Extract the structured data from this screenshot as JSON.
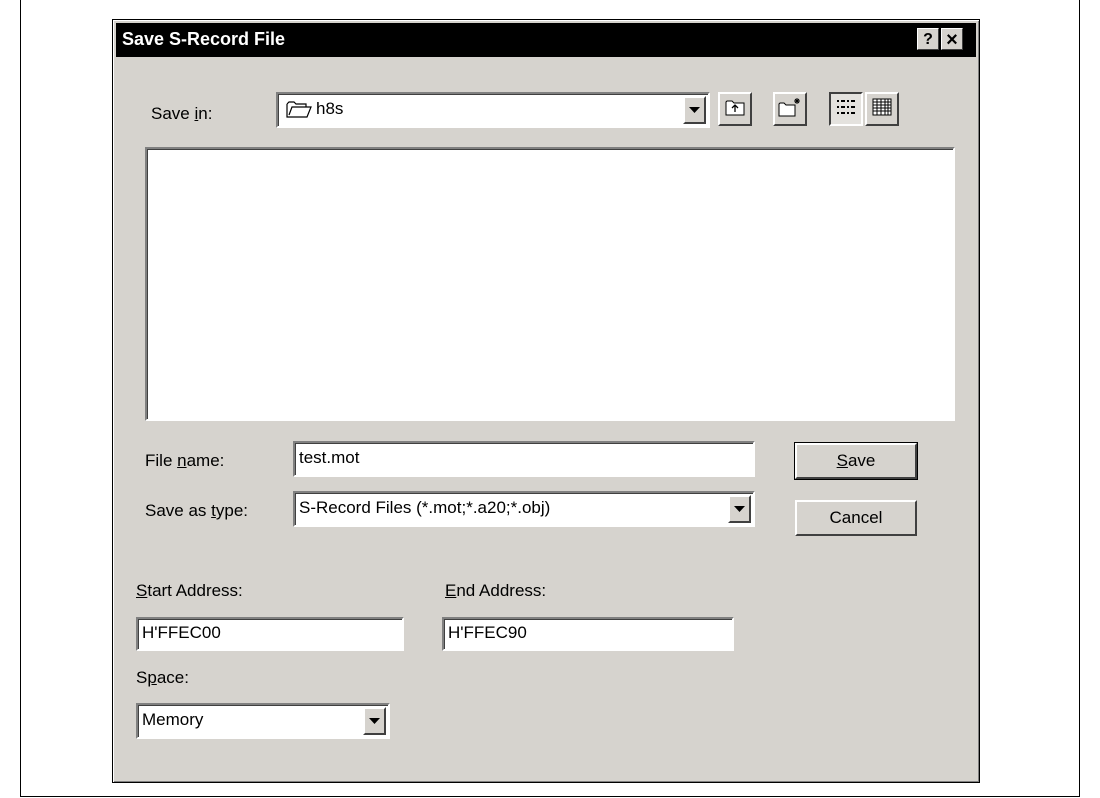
{
  "dialog": {
    "title": "Save S-Record File",
    "help_glyph": "?",
    "close_glyph": "×"
  },
  "save_in": {
    "label_pre": "Save ",
    "label_accel": "i",
    "label_post": "n:",
    "value": "h8s",
    "folder_icon": "folder-icon"
  },
  "toolbar": {
    "icons": [
      "up-one-level-icon",
      "new-folder-icon",
      "list-view-icon",
      "details-view-icon"
    ]
  },
  "file_name": {
    "label_pre": "File ",
    "label_accel": "n",
    "label_post": "ame:",
    "value": "test.mot"
  },
  "save_as_type": {
    "label_pre": "Save as ",
    "label_accel": "t",
    "label_post": "ype:",
    "value": "S-Record Files (*.mot;*.a20;*.obj)"
  },
  "buttons": {
    "save_accel": "S",
    "save_rest": "ave",
    "cancel": "Cancel"
  },
  "start_address": {
    "label_accel": "S",
    "label_rest": "tart Address:",
    "value": "H'FFEC00"
  },
  "end_address": {
    "label_accel": "E",
    "label_rest": "nd Address:",
    "value": "H'FFEC90"
  },
  "space": {
    "label_pre": "S",
    "label_accel": "p",
    "label_post": "ace:",
    "value": "Memory"
  },
  "colors": {
    "dialog_face": "#d6d3ce",
    "titlebar": "#000000",
    "field": "#ffffff"
  }
}
